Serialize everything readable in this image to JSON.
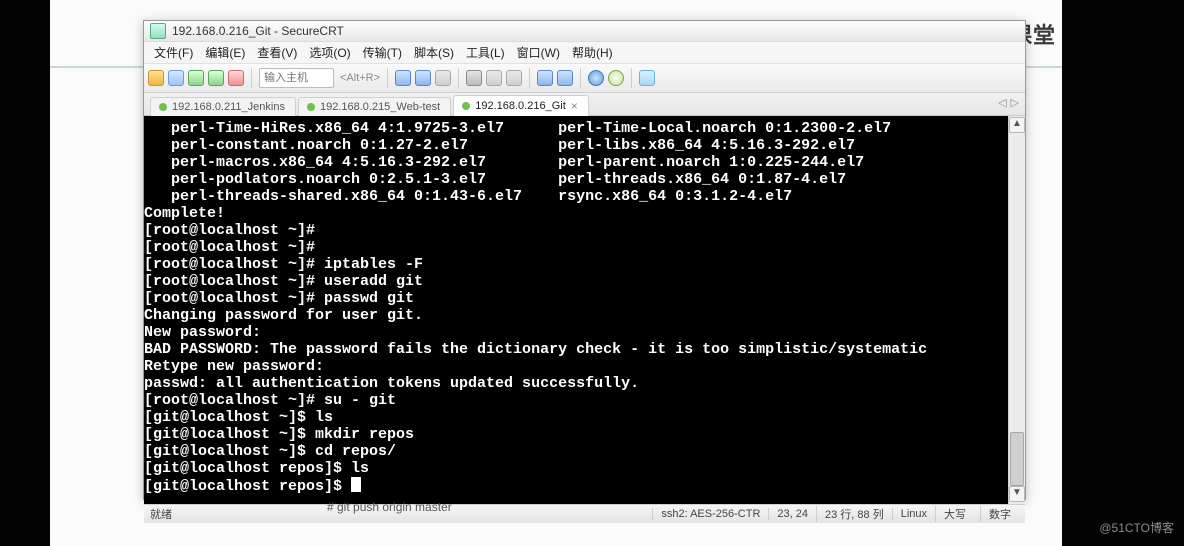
{
  "brand": {
    "text": "腾讯课堂"
  },
  "credit": "@51CTO博客",
  "window": {
    "title": "192.168.0.216_Git - SecureCRT",
    "menus": [
      "文件(F)",
      "编辑(E)",
      "查看(V)",
      "选项(O)",
      "传输(T)",
      "脚本(S)",
      "工具(L)",
      "窗口(W)",
      "帮助(H)"
    ],
    "host_placeholder": "输入主机",
    "host_hint": "<Alt+R>",
    "tabs": [
      {
        "label": "192.168.0.211_Jenkins",
        "connected": true,
        "active": false
      },
      {
        "label": "192.168.0.215_Web-test",
        "connected": true,
        "active": false
      },
      {
        "label": "192.168.0.216_Git",
        "connected": true,
        "active": true
      }
    ],
    "tab_nav": {
      "left": "◁",
      "right": "▷"
    },
    "terminal_lines": [
      "   perl-Time-HiRes.x86_64 4:1.9725-3.el7      perl-Time-Local.noarch 0:1.2300-2.el7",
      "   perl-constant.noarch 0:1.27-2.el7          perl-libs.x86_64 4:5.16.3-292.el7",
      "   perl-macros.x86_64 4:5.16.3-292.el7        perl-parent.noarch 1:0.225-244.el7",
      "   perl-podlators.noarch 0:2.5.1-3.el7        perl-threads.x86_64 0:1.87-4.el7",
      "   perl-threads-shared.x86_64 0:1.43-6.el7    rsync.x86_64 0:3.1.2-4.el7",
      "",
      "Complete!",
      "[root@localhost ~]# ",
      "[root@localhost ~]# ",
      "[root@localhost ~]# iptables -F",
      "[root@localhost ~]# useradd git",
      "[root@localhost ~]# passwd git",
      "Changing password for user git.",
      "New password:",
      "BAD PASSWORD: The password fails the dictionary check - it is too simplistic/systematic",
      "Retype new password:",
      "passwd: all authentication tokens updated successfully.",
      "[root@localhost ~]# su - git",
      "[git@localhost ~]$ ls",
      "[git@localhost ~]$ mkdir repos",
      "[git@localhost ~]$ cd repos/",
      "[git@localhost repos]$ ls",
      "[git@localhost repos]$ "
    ],
    "status": {
      "ready": "就绪",
      "cipher": "ssh2: AES-256-CTR",
      "pos": "23, 24",
      "size": "23 行, 88 列",
      "proto": "Linux",
      "caps": "大写",
      "num": "数字"
    }
  },
  "caption": "# git push origin master"
}
